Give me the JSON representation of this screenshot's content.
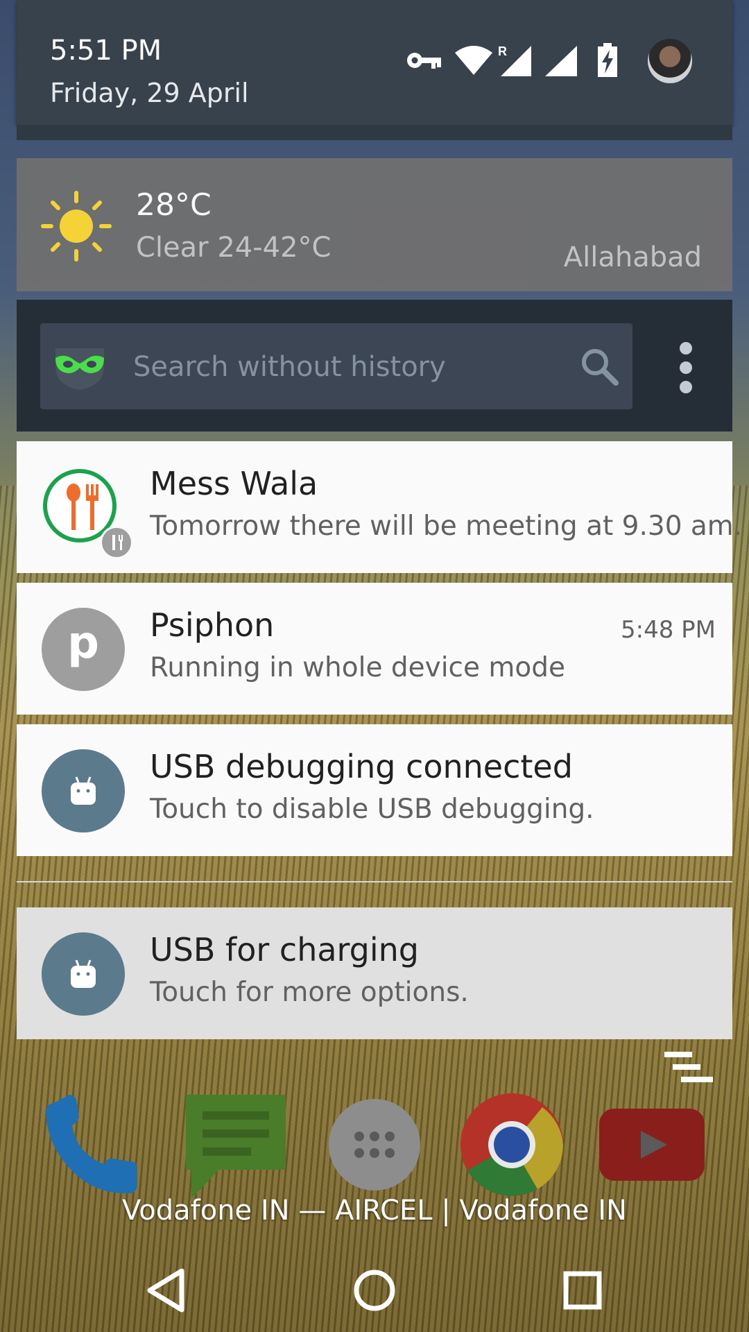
{
  "status_bar": {
    "time": "5:51 PM",
    "date": "Friday, 29 April",
    "roaming_indicator": "R",
    "icons": [
      "vpn-key-icon",
      "wifi-icon",
      "cell-signal-roaming-icon",
      "cell-signal-icon",
      "battery-charging-icon",
      "user-avatar"
    ]
  },
  "weather": {
    "temperature": "28°C",
    "condition": "Clear 24-42°C",
    "city": "Allahabad",
    "icon": "sun-icon"
  },
  "search": {
    "placeholder": "Search without history",
    "app_icon": "incognito-mask-icon"
  },
  "notifications": [
    {
      "app": "Mess Wala",
      "text": "Tomorrow there will be meeting at 9.30 am.",
      "time": "",
      "icon": "mess-wala-icon"
    },
    {
      "app": "Psiphon",
      "text": "Running in whole device mode",
      "time": "5:48 PM",
      "icon_letter": "p"
    },
    {
      "app": "USB debugging connected",
      "text": "Touch to disable USB debugging.",
      "time": "",
      "icon": "android-icon"
    },
    {
      "app": "USB for charging",
      "text": "Touch for more options.",
      "time": "",
      "icon": "android-icon"
    }
  ],
  "dock": {
    "apps": [
      "phone-icon",
      "messages-icon",
      "app-drawer-icon",
      "chrome-icon",
      "youtube-icon"
    ]
  },
  "carrier_text": "Vodafone IN — AIRCEL | Vodafone IN",
  "colors": {
    "header_bg": "#37424d",
    "notification_bg": "#fafafa",
    "usb_icon_bg": "#5b7a8c",
    "psiphon_icon_bg": "#9e9e9e"
  }
}
